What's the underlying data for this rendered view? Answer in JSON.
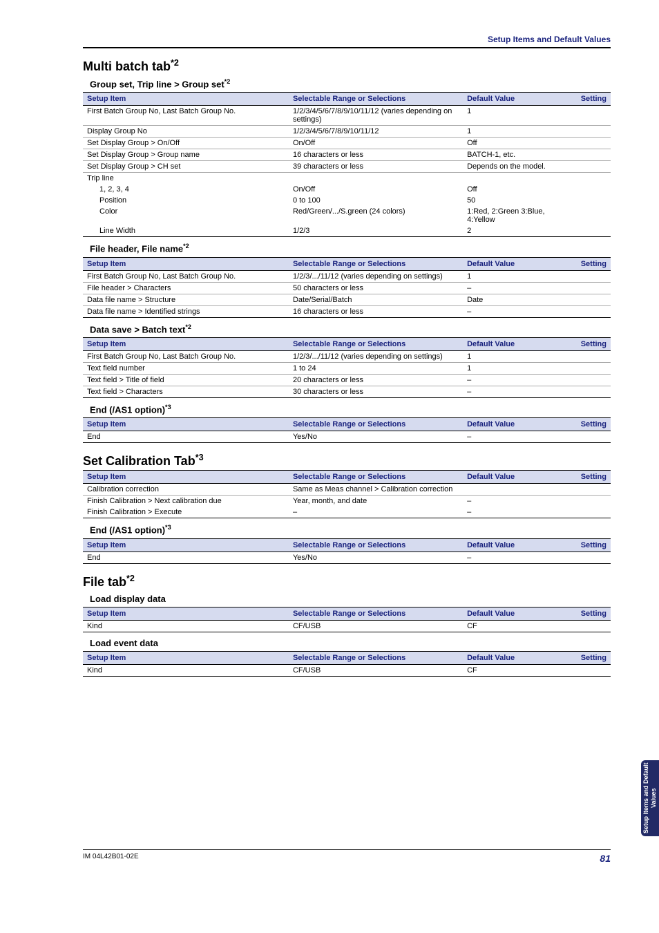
{
  "top_header": "Setup Items and Default Values",
  "side_tab": "Setup Items and\nDefault Values",
  "footer_left": "IM 04L42B01-02E",
  "footer_page": "81",
  "cols": {
    "item": "Setup Item",
    "sel": "Selectable Range or Selections",
    "def": "Default Value",
    "set": "Setting"
  },
  "sections": [
    {
      "h1": "Multi batch tab",
      "h1_sup": "*2",
      "groups": [
        {
          "h2": "Group set, Trip line > Group set",
          "h2_sup": "*2",
          "rows": [
            {
              "item": "First Batch Group No, Last Batch Group No.",
              "sel": "1/2/3/4/5/6/7/8/9/10/11/12 (varies depending on settings)",
              "def": "1",
              "set": ""
            },
            {
              "item": "Display Group No",
              "sel": "1/2/3/4/5/6/7/8/9/10/11/12",
              "def": "1",
              "set": ""
            },
            {
              "item": "Set Display Group > On/Off",
              "sel": "On/Off",
              "def": "Off",
              "set": ""
            },
            {
              "item": "Set Display Group > Group name",
              "sel": "16 characters or less",
              "def": "BATCH-1, etc.",
              "set": ""
            },
            {
              "item": "Set Display Group > CH set",
              "sel": "39 characters or less",
              "def": "Depends on the model.",
              "set": ""
            },
            {
              "item": "Trip line",
              "sel": "",
              "def": "",
              "set": "",
              "noborder": true
            },
            {
              "item": "1, 2, 3, 4",
              "sel": "On/Off",
              "def": "Off",
              "set": "",
              "indent": true,
              "noborder": true
            },
            {
              "item": "Position",
              "sel": "0 to 100",
              "def": "50",
              "set": "",
              "indent": true,
              "noborder": true
            },
            {
              "item": "Color",
              "sel": "Red/Green/.../S.green (24 colors)",
              "def": "1:Red, 2:Green 3:Blue, 4:Yellow",
              "set": "",
              "indent": true,
              "noborder": true
            },
            {
              "item": "Line Width",
              "sel": "1/2/3",
              "def": "2",
              "set": "",
              "indent": true
            }
          ]
        },
        {
          "h2": "File header, File name",
          "h2_sup": "*2",
          "rows": [
            {
              "item": "First Batch Group No, Last Batch Group No.",
              "sel": "1/2/3/.../11/12 (varies depending on settings)",
              "def": "1",
              "set": ""
            },
            {
              "item": "File header > Characters",
              "sel": "50 characters or less",
              "def": "–",
              "set": ""
            },
            {
              "item": "Data file name > Structure",
              "sel": "Date/Serial/Batch",
              "def": "Date",
              "set": ""
            },
            {
              "item": "Data file name > Identified strings",
              "sel": "16 characters or less",
              "def": "–",
              "set": ""
            }
          ]
        },
        {
          "h2": "Data save > Batch text",
          "h2_sup": "*2",
          "rows": [
            {
              "item": "First Batch Group No, Last Batch Group No.",
              "sel": "1/2/3/.../11/12 (varies depending on settings)",
              "def": "1",
              "set": ""
            },
            {
              "item": "Text field number",
              "sel": "1 to 24",
              "def": "1",
              "set": ""
            },
            {
              "item": "Text field > Title of field",
              "sel": "20 characters or less",
              "def": "–",
              "set": ""
            },
            {
              "item": "Text field > Characters",
              "sel": "30 characters or less",
              "def": "–",
              "set": ""
            }
          ]
        },
        {
          "h2": "End (/AS1 option)",
          "h2_sup": "*3",
          "rows": [
            {
              "item": "End",
              "sel": "Yes/No",
              "def": "–",
              "set": ""
            }
          ]
        }
      ]
    },
    {
      "h1": "Set Calibration Tab",
      "h1_sup": "*3",
      "groups": [
        {
          "rows": [
            {
              "item": "Calibration correction",
              "sel": "Same as Meas channel > Calibration correction",
              "def": "",
              "set": ""
            },
            {
              "item": "Finish Calibration > Next calibration due",
              "sel": "Year, month, and date",
              "def": "–",
              "set": "",
              "noborder": true
            },
            {
              "item": "Finish Calibration > Execute",
              "sel": "–",
              "def": "–",
              "set": ""
            }
          ]
        },
        {
          "h2": "End (/AS1 option)",
          "h2_sup": "*3",
          "rows": [
            {
              "item": "End",
              "sel": "Yes/No",
              "def": "–",
              "set": ""
            }
          ]
        }
      ]
    },
    {
      "h1": "File tab",
      "h1_sup": "*2",
      "groups": [
        {
          "h2": "Load display data",
          "rows": [
            {
              "item": "Kind",
              "sel": "CF/USB",
              "def": "CF",
              "set": ""
            }
          ]
        },
        {
          "h2": "Load event data",
          "rows": [
            {
              "item": "Kind",
              "sel": "CF/USB",
              "def": "CF",
              "set": ""
            }
          ]
        }
      ]
    }
  ]
}
